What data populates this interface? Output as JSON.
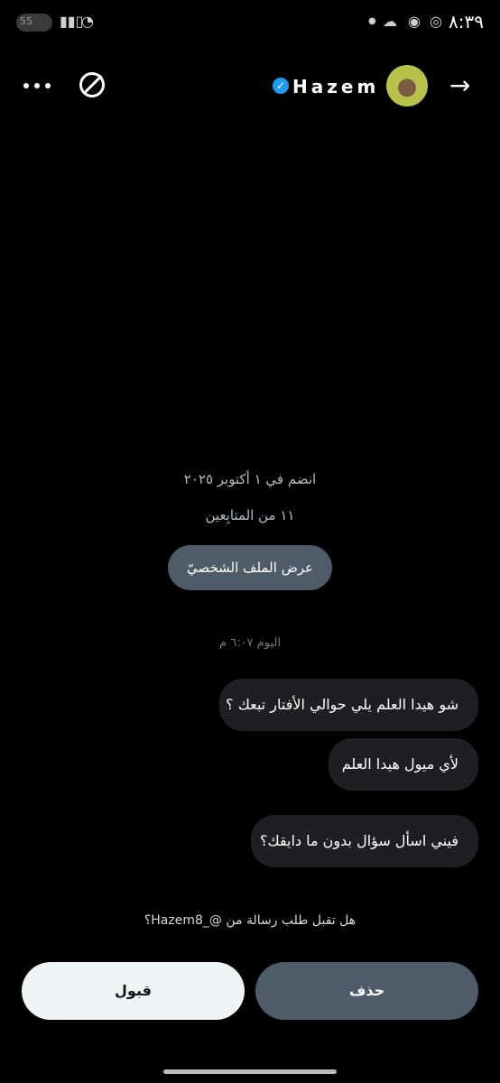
{
  "status_bar": {
    "time": "٨:٣٩",
    "battery": "55",
    "icons": [
      "notification-dot-icon",
      "cloud-icon",
      "snapchat-icon",
      "whatsapp-icon",
      "wifi-icon",
      "signal-icon"
    ]
  },
  "header": {
    "name": "Hazem",
    "verified": true,
    "more_icon": "more-icon",
    "block_icon": "block-icon",
    "back_icon": "arrow-right-icon"
  },
  "profile": {
    "joined": "انضم في ١ أكتوبر ٢٠٢٥",
    "followers": "١١ من المتابِعين",
    "view_profile_label": "عرض الملف الشخصيّ"
  },
  "conversation": {
    "timestamp": "اليوم ٦:٠٧ م",
    "messages": [
      "شو هيدا العلم يلي حوالي الأفتار تبعك ؟",
      "لأي ميول هيدا العلم",
      "فيني اسأل سؤال بدون ما دايقك؟"
    ]
  },
  "request": {
    "question": "هل تقبل طلب رسالة من @_Hazem8؟",
    "accept_label": "قبول",
    "delete_label": "حذف"
  },
  "colors": {
    "background": "#000000",
    "bubble": "#1f1f21",
    "primary_button": "#4d5c68",
    "accept_button": "#eff3f4",
    "verified": "#1d9bf0"
  }
}
